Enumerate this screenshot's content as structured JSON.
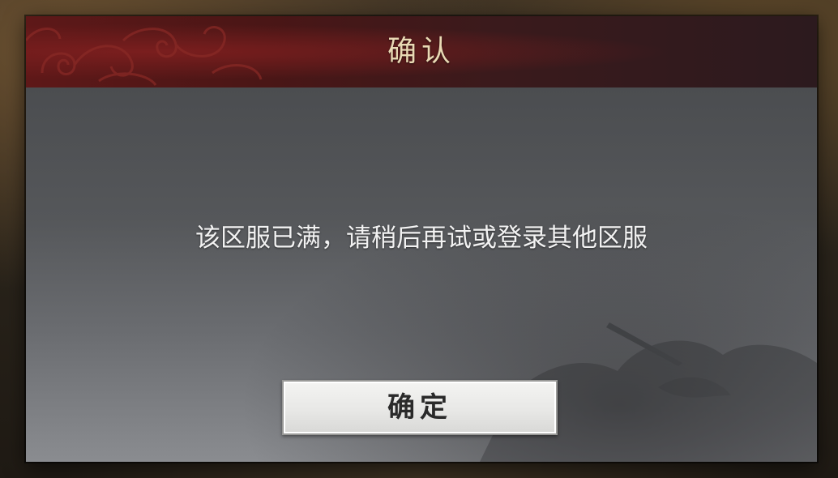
{
  "dialog": {
    "title": "确认",
    "message": "该区服已满，请稍后再试或登录其他区服",
    "confirm_label": "确定"
  },
  "colors": {
    "header_red": "#5e1818",
    "title_gold": "#e9d9b4",
    "body_gray": "#55575a",
    "button_face": "#eeeeec"
  },
  "icons": [
    "cloud-pattern-icon",
    "ink-landscape-icon"
  ]
}
